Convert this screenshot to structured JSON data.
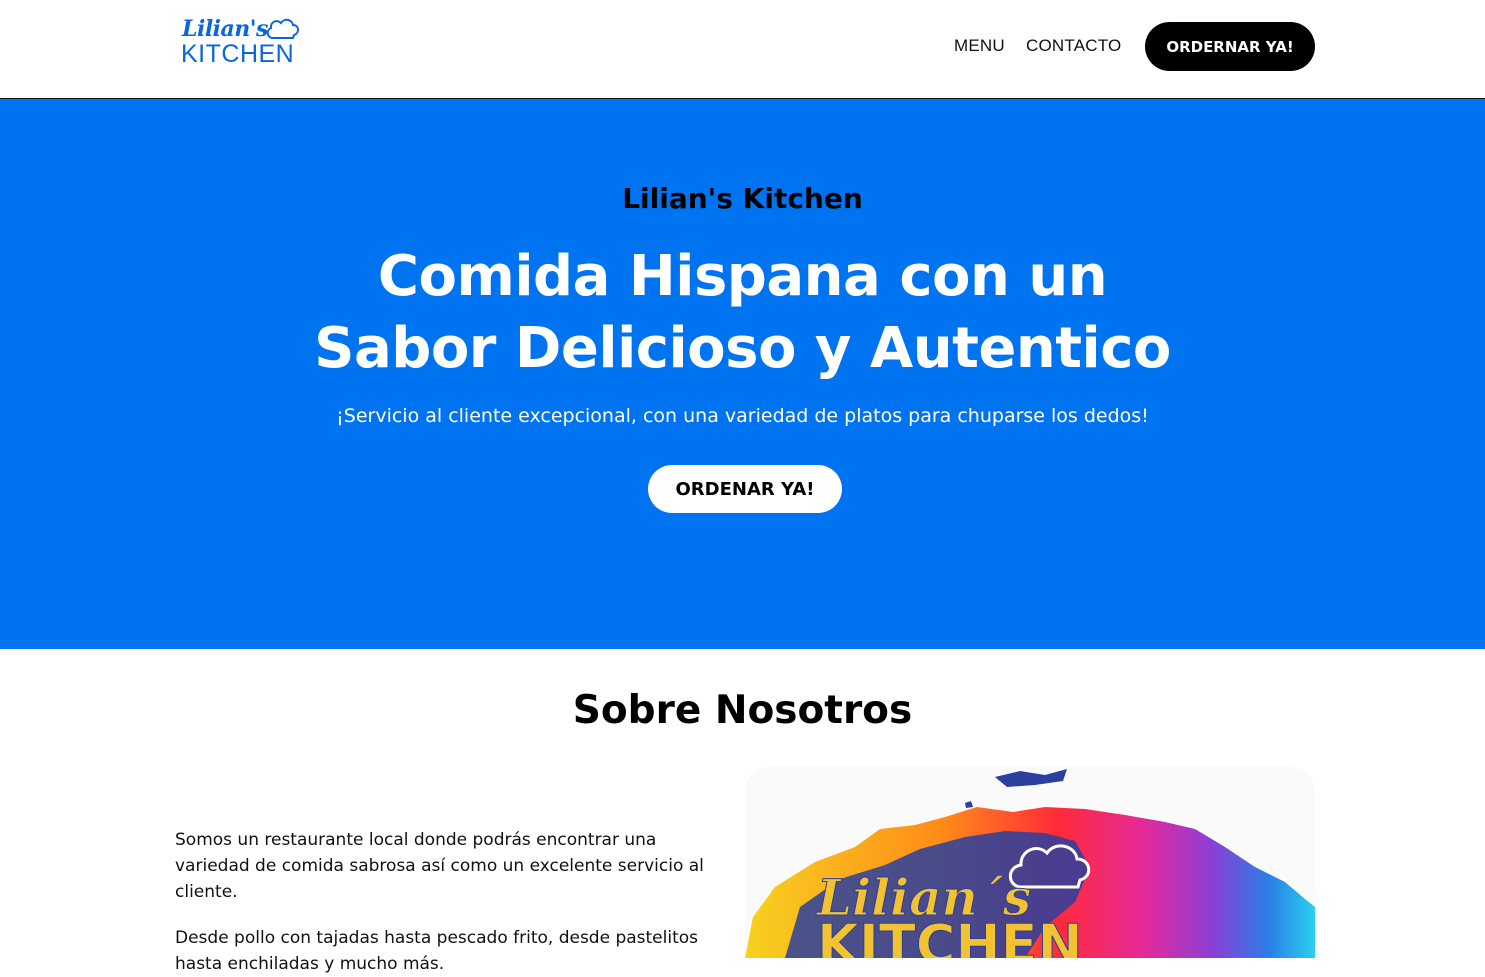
{
  "header": {
    "logo": {
      "script_text": "Lilian's",
      "word_text": "KITCHEN",
      "hat_icon": "chef-hat-icon",
      "utensil_icon": "fork-spoon-icon"
    },
    "nav": [
      {
        "label": "MENU"
      },
      {
        "label": "CONTACTO"
      }
    ],
    "cta_label": "ORDERNAR YA!"
  },
  "hero": {
    "subtitle": "Lilian's Kitchen",
    "title_line1": "Comida Hispana con un",
    "title_line2": "Sabor Delicioso y Autentico",
    "tagline": "¡Servicio al cliente excepcional, con una variedad de platos para chuparse los dedos!",
    "cta_label": "ORDENAR YA!"
  },
  "about": {
    "title": "Sobre Nosotros",
    "paragraphs": [
      "Somos un restaurante local donde podrás encontrar una variedad de comida sabrosa así como un excelente servicio al cliente.",
      "Desde pollo con tajadas hasta pescado frito, desde pastelitos hasta enchiladas y mucho más."
    ],
    "image": {
      "script_text": "Lilian´s",
      "word_text": "KITCHEN"
    }
  },
  "colors": {
    "brand_blue": "#0073f0",
    "logo_blue": "#0a66e0",
    "black": "#000000",
    "white": "#ffffff",
    "gold": "#f2c230",
    "navy": "#2a3f9e"
  }
}
